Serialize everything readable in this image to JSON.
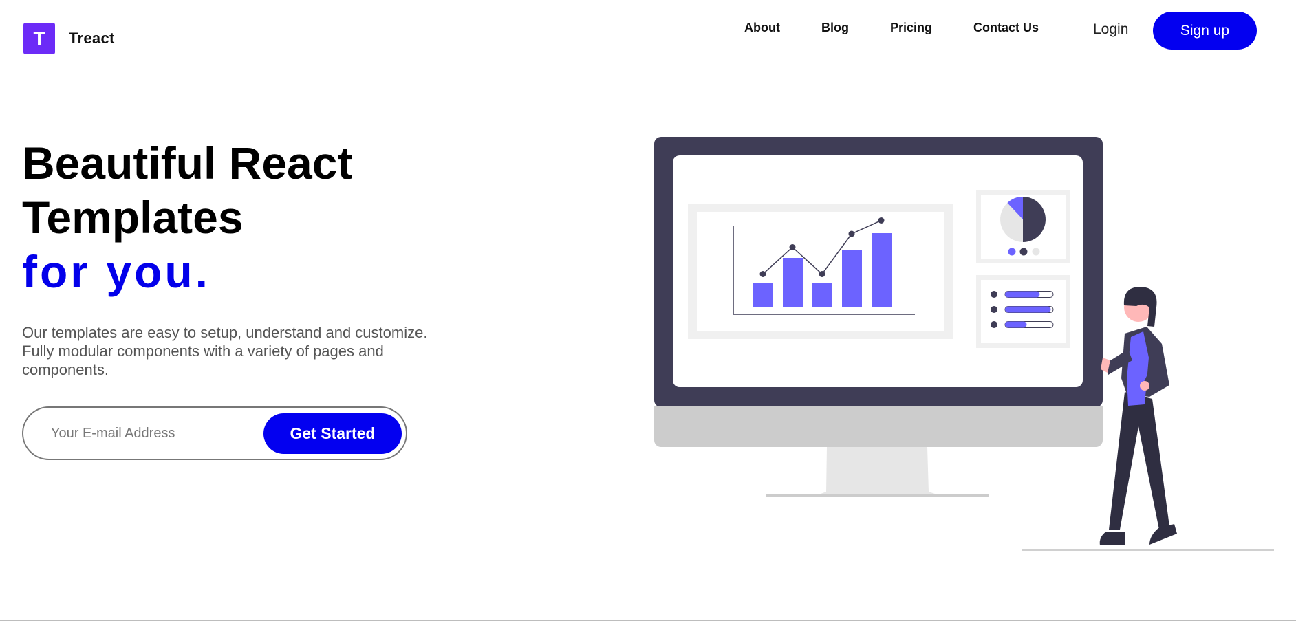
{
  "header": {
    "logo_letter": "T",
    "brand_name": "Treact",
    "nav": [
      {
        "label": "About"
      },
      {
        "label": "Blog"
      },
      {
        "label": "Pricing"
      },
      {
        "label": "Contact Us"
      }
    ],
    "login_label": "Login",
    "signup_label": "Sign up"
  },
  "hero": {
    "title_line1": "Beautiful React",
    "title_line2": "Templates",
    "title_accent": "for you.",
    "description": "Our templates are easy to setup, understand and customize. Fully modular components with a variety of pages and components.",
    "email_placeholder": "Your E-mail Address",
    "cta_label": "Get Started"
  },
  "colors": {
    "brand_purple": "#6c2bf7",
    "primary_blue": "#0300f0",
    "illustration_accent": "#6c63ff",
    "illustration_dark": "#3f3d56"
  },
  "illustration": {
    "icon": "person-presenting-dashboard-illustration",
    "bar_chart_values": [
      3,
      6,
      3,
      7,
      9
    ],
    "line_chart_values": [
      3,
      5,
      3,
      6,
      7
    ],
    "pie_slices": [
      0.5,
      0.38,
      0.12
    ],
    "progress_levels": [
      0.72,
      0.95,
      0.45
    ]
  }
}
